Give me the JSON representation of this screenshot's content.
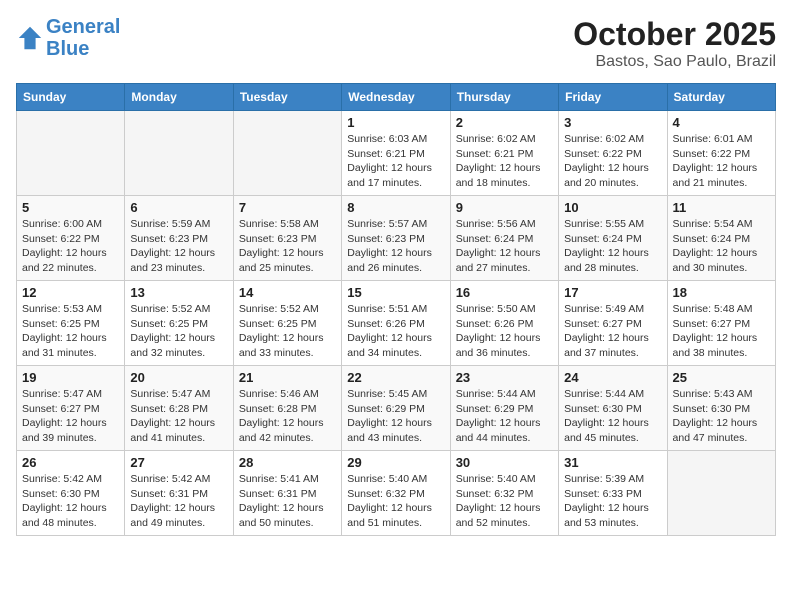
{
  "header": {
    "logo_line1": "General",
    "logo_line2": "Blue",
    "month": "October 2025",
    "location": "Bastos, Sao Paulo, Brazil"
  },
  "weekdays": [
    "Sunday",
    "Monday",
    "Tuesday",
    "Wednesday",
    "Thursday",
    "Friday",
    "Saturday"
  ],
  "weeks": [
    [
      {
        "day": "",
        "info": ""
      },
      {
        "day": "",
        "info": ""
      },
      {
        "day": "",
        "info": ""
      },
      {
        "day": "1",
        "info": "Sunrise: 6:03 AM\nSunset: 6:21 PM\nDaylight: 12 hours\nand 17 minutes."
      },
      {
        "day": "2",
        "info": "Sunrise: 6:02 AM\nSunset: 6:21 PM\nDaylight: 12 hours\nand 18 minutes."
      },
      {
        "day": "3",
        "info": "Sunrise: 6:02 AM\nSunset: 6:22 PM\nDaylight: 12 hours\nand 20 minutes."
      },
      {
        "day": "4",
        "info": "Sunrise: 6:01 AM\nSunset: 6:22 PM\nDaylight: 12 hours\nand 21 minutes."
      }
    ],
    [
      {
        "day": "5",
        "info": "Sunrise: 6:00 AM\nSunset: 6:22 PM\nDaylight: 12 hours\nand 22 minutes."
      },
      {
        "day": "6",
        "info": "Sunrise: 5:59 AM\nSunset: 6:23 PM\nDaylight: 12 hours\nand 23 minutes."
      },
      {
        "day": "7",
        "info": "Sunrise: 5:58 AM\nSunset: 6:23 PM\nDaylight: 12 hours\nand 25 minutes."
      },
      {
        "day": "8",
        "info": "Sunrise: 5:57 AM\nSunset: 6:23 PM\nDaylight: 12 hours\nand 26 minutes."
      },
      {
        "day": "9",
        "info": "Sunrise: 5:56 AM\nSunset: 6:24 PM\nDaylight: 12 hours\nand 27 minutes."
      },
      {
        "day": "10",
        "info": "Sunrise: 5:55 AM\nSunset: 6:24 PM\nDaylight: 12 hours\nand 28 minutes."
      },
      {
        "day": "11",
        "info": "Sunrise: 5:54 AM\nSunset: 6:24 PM\nDaylight: 12 hours\nand 30 minutes."
      }
    ],
    [
      {
        "day": "12",
        "info": "Sunrise: 5:53 AM\nSunset: 6:25 PM\nDaylight: 12 hours\nand 31 minutes."
      },
      {
        "day": "13",
        "info": "Sunrise: 5:52 AM\nSunset: 6:25 PM\nDaylight: 12 hours\nand 32 minutes."
      },
      {
        "day": "14",
        "info": "Sunrise: 5:52 AM\nSunset: 6:25 PM\nDaylight: 12 hours\nand 33 minutes."
      },
      {
        "day": "15",
        "info": "Sunrise: 5:51 AM\nSunset: 6:26 PM\nDaylight: 12 hours\nand 34 minutes."
      },
      {
        "day": "16",
        "info": "Sunrise: 5:50 AM\nSunset: 6:26 PM\nDaylight: 12 hours\nand 36 minutes."
      },
      {
        "day": "17",
        "info": "Sunrise: 5:49 AM\nSunset: 6:27 PM\nDaylight: 12 hours\nand 37 minutes."
      },
      {
        "day": "18",
        "info": "Sunrise: 5:48 AM\nSunset: 6:27 PM\nDaylight: 12 hours\nand 38 minutes."
      }
    ],
    [
      {
        "day": "19",
        "info": "Sunrise: 5:47 AM\nSunset: 6:27 PM\nDaylight: 12 hours\nand 39 minutes."
      },
      {
        "day": "20",
        "info": "Sunrise: 5:47 AM\nSunset: 6:28 PM\nDaylight: 12 hours\nand 41 minutes."
      },
      {
        "day": "21",
        "info": "Sunrise: 5:46 AM\nSunset: 6:28 PM\nDaylight: 12 hours\nand 42 minutes."
      },
      {
        "day": "22",
        "info": "Sunrise: 5:45 AM\nSunset: 6:29 PM\nDaylight: 12 hours\nand 43 minutes."
      },
      {
        "day": "23",
        "info": "Sunrise: 5:44 AM\nSunset: 6:29 PM\nDaylight: 12 hours\nand 44 minutes."
      },
      {
        "day": "24",
        "info": "Sunrise: 5:44 AM\nSunset: 6:30 PM\nDaylight: 12 hours\nand 45 minutes."
      },
      {
        "day": "25",
        "info": "Sunrise: 5:43 AM\nSunset: 6:30 PM\nDaylight: 12 hours\nand 47 minutes."
      }
    ],
    [
      {
        "day": "26",
        "info": "Sunrise: 5:42 AM\nSunset: 6:30 PM\nDaylight: 12 hours\nand 48 minutes."
      },
      {
        "day": "27",
        "info": "Sunrise: 5:42 AM\nSunset: 6:31 PM\nDaylight: 12 hours\nand 49 minutes."
      },
      {
        "day": "28",
        "info": "Sunrise: 5:41 AM\nSunset: 6:31 PM\nDaylight: 12 hours\nand 50 minutes."
      },
      {
        "day": "29",
        "info": "Sunrise: 5:40 AM\nSunset: 6:32 PM\nDaylight: 12 hours\nand 51 minutes."
      },
      {
        "day": "30",
        "info": "Sunrise: 5:40 AM\nSunset: 6:32 PM\nDaylight: 12 hours\nand 52 minutes."
      },
      {
        "day": "31",
        "info": "Sunrise: 5:39 AM\nSunset: 6:33 PM\nDaylight: 12 hours\nand 53 minutes."
      },
      {
        "day": "",
        "info": ""
      }
    ]
  ]
}
